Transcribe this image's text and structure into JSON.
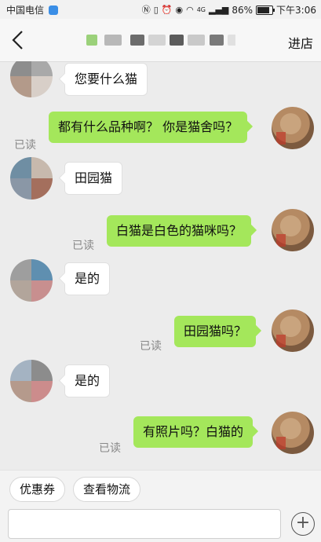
{
  "status_bar": {
    "carrier": "中国电信",
    "network": "4G",
    "battery": "86%",
    "battery_level": 0.86,
    "time": "下午3:06"
  },
  "header": {
    "title_blurred": true,
    "enter_store": "进店"
  },
  "messages": [
    {
      "side": "left",
      "text": "您要什么猫"
    },
    {
      "side": "right",
      "text": "都有什么品种啊？ 你是猫舍吗？",
      "status": "已读"
    },
    {
      "side": "left",
      "text": "田园猫"
    },
    {
      "side": "right",
      "text": "白猫是白色的猫咪吗？",
      "status": "已读"
    },
    {
      "side": "left",
      "text": "是的"
    },
    {
      "side": "right",
      "text": "田园猫吗？",
      "status": "已读"
    },
    {
      "side": "left",
      "text": "是的"
    },
    {
      "side": "right",
      "text": "有照片吗？白猫的",
      "status": "已读"
    }
  ],
  "quick_actions": {
    "coupon": "优惠券",
    "logistics": "查看物流"
  },
  "input": {
    "value": "",
    "placeholder": ""
  },
  "colors": {
    "sent_bubble": "#a4e75b",
    "received_bubble": "#ffffff",
    "background": "#ececec"
  }
}
